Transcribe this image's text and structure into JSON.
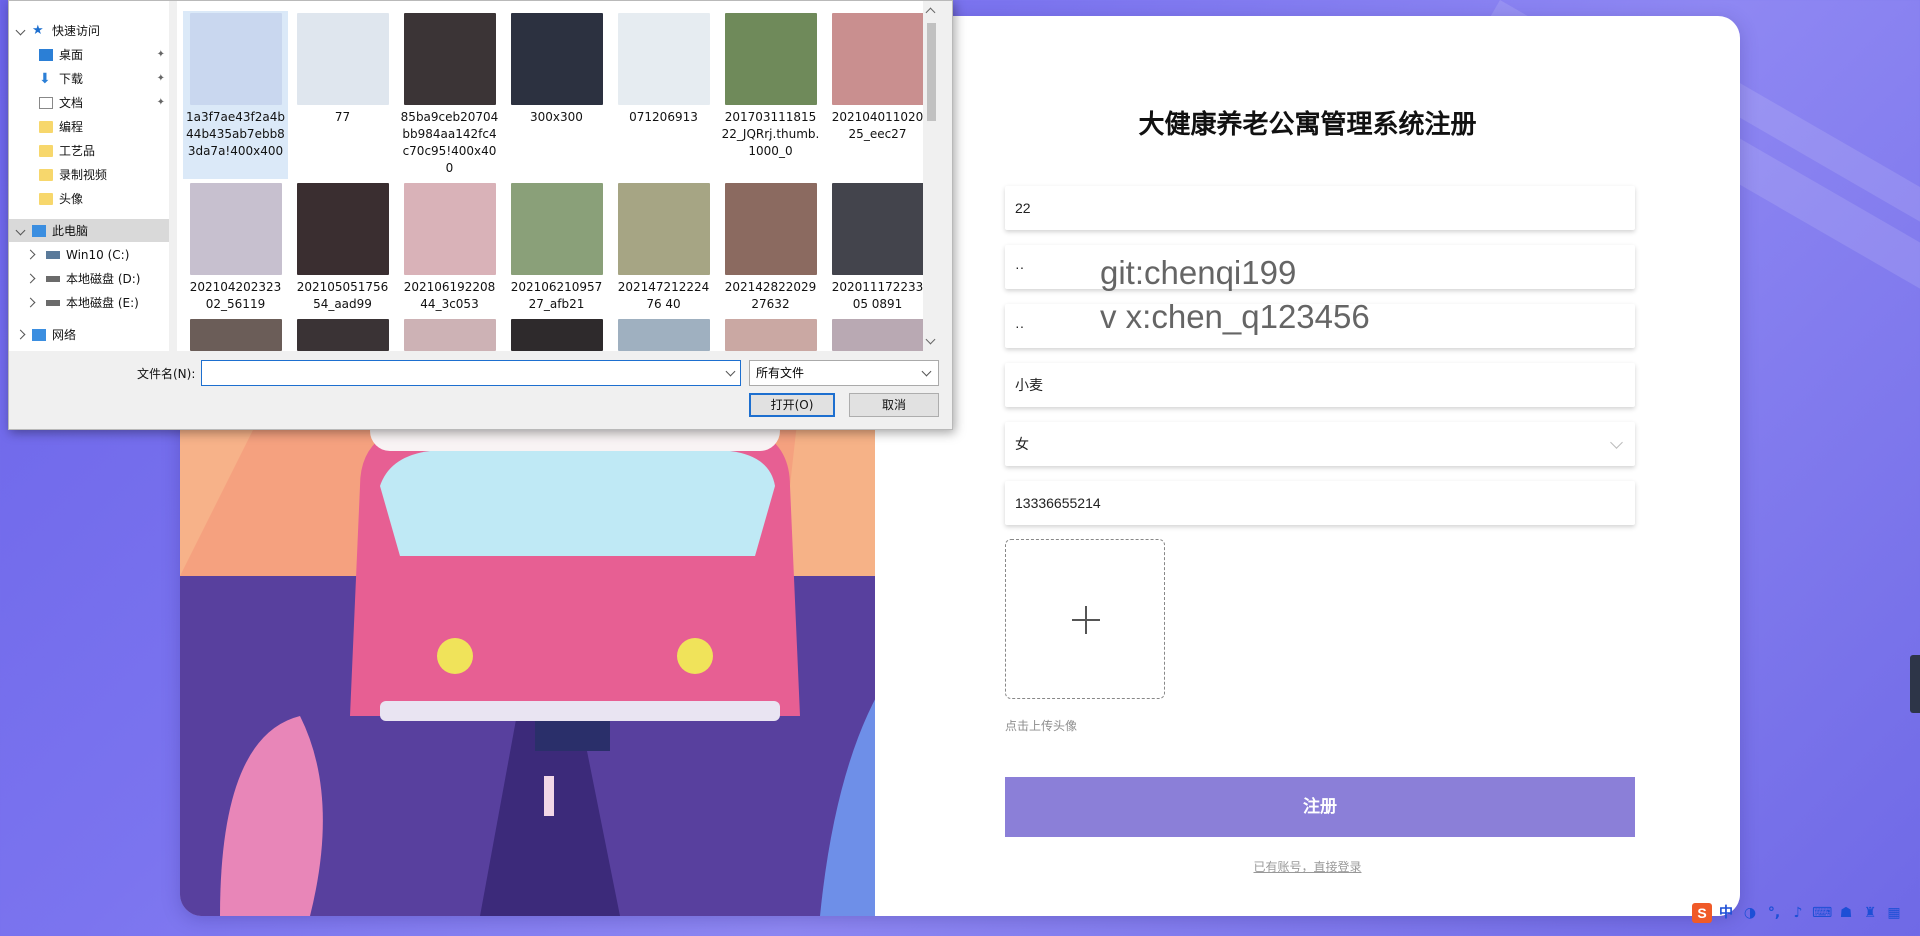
{
  "register": {
    "title": "大健康养老公寓管理系统注册",
    "fields": {
      "account": "22",
      "password": "··",
      "confirm": "··",
      "name": "小麦",
      "gender": "女",
      "phone": "13336655214"
    },
    "upload_hint": "点击上传头像",
    "submit_label": "注册",
    "login_link": "已有账号，直接登录"
  },
  "watermark": {
    "line1": "git:chenqi199",
    "line2": "v x:chen_q123456"
  },
  "dialog": {
    "nav": {
      "quick_access": "快速访问",
      "desktop": "桌面",
      "downloads": "下载",
      "documents": "文档",
      "programming": "编程",
      "crafts": "工艺品",
      "recordings": "录制视频",
      "avatars": "头像",
      "this_pc": "此电脑",
      "drive_c": "Win10 (C:)",
      "drive_d": "本地磁盘 (D:)",
      "drive_e": "本地磁盘 (E:)",
      "network": "网络"
    },
    "files": [
      {
        "name": "1a3f7ae43f2a4b44b435ab7ebb83da7a!400x400",
        "color": "#c9d7ef"
      },
      {
        "name": "77",
        "color": "#dfe6ee"
      },
      {
        "name": "85ba9ceb20704bb984aa142fc4c70c95!400x400",
        "color": "#3b3436"
      },
      {
        "name": "300x300",
        "color": "#2c3140"
      },
      {
        "name": "071206913",
        "color": "#e6ecf1"
      },
      {
        "name": "20170311181522_JQRrj.thumb.1000_0",
        "color": "#6f8a5a"
      },
      {
        "name": "20210401102025_eec27",
        "color": "#c98f8f"
      },
      {
        "name": "20210420232302_56119",
        "color": "#c7c0cf"
      },
      {
        "name": "20210505175654_aad99",
        "color": "#3a2e30"
      },
      {
        "name": "20210619220844_3c053",
        "color": "#d9b2b8"
      },
      {
        "name": "20210621095727_afb21",
        "color": "#8aa079"
      },
      {
        "name": "20214721222476 40",
        "color": "#a6a584"
      },
      {
        "name": "20214282202927632",
        "color": "#8b6a60"
      },
      {
        "name": "20201117223305 0891",
        "color": "#43444c"
      }
    ],
    "filename_label": "文件名(N):",
    "filename_value": "",
    "file_type": "所有文件",
    "open_label": "打开(O)",
    "cancel_label": "取消"
  },
  "tray": {
    "ime_logo": "S",
    "ime_mode": "中",
    "moon": "◑",
    "punct": "°,",
    "mic": "♪",
    "keyboard": "⌨",
    "user": "☗",
    "shirt": "♜",
    "grid": "▦"
  },
  "colors": {
    "accent": "#8b7fd8",
    "background": "#7b74ef",
    "selection": "#dbe9f8"
  }
}
